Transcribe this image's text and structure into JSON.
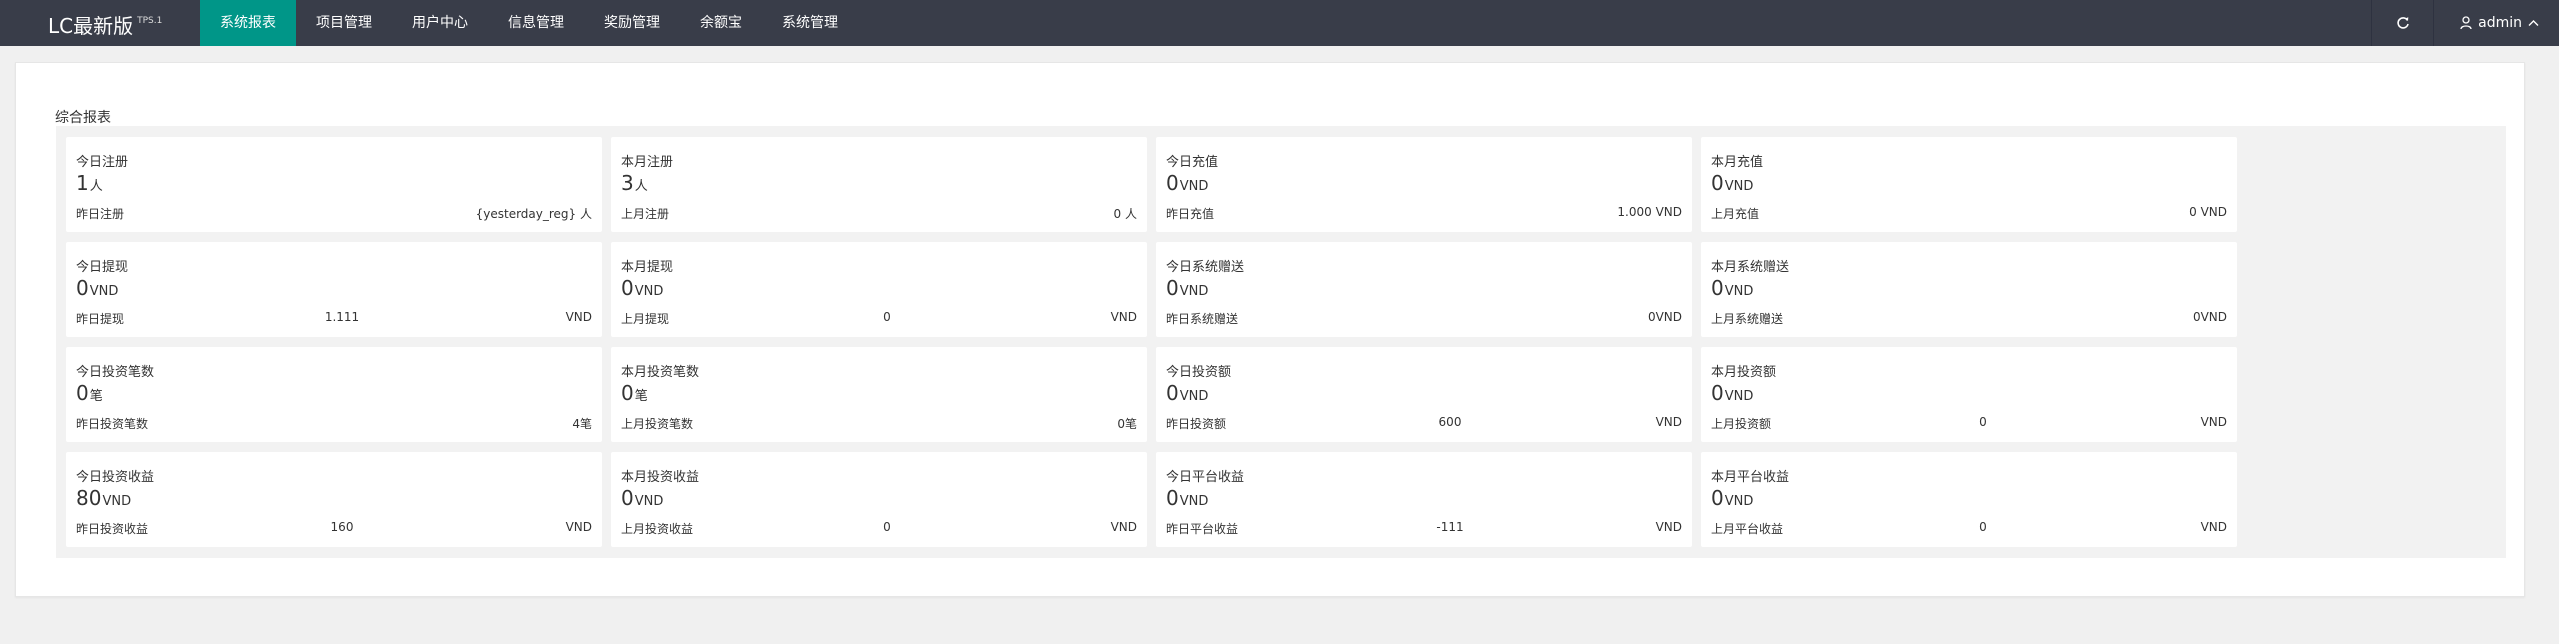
{
  "header": {
    "logo": "LC最新版",
    "logo_sup": "TPS.1",
    "nav": [
      "系统报表",
      "项目管理",
      "用户中心",
      "信息管理",
      "奖励管理",
      "余额宝",
      "系统管理"
    ],
    "admin": "admin"
  },
  "main": {
    "section_title": "综合报表",
    "cards": [
      {
        "title": "今日注册",
        "value": "1",
        "unit": "人",
        "prev_label": "昨日注册",
        "prev_mid": "",
        "prev_right": "{yesterday_reg} 人"
      },
      {
        "title": "本月注册",
        "value": "3",
        "unit": "人",
        "prev_label": "上月注册",
        "prev_mid": "",
        "prev_right": "0 人"
      },
      {
        "title": "今日充值",
        "value": "0",
        "unit": "VND",
        "prev_label": "昨日充值",
        "prev_mid": "",
        "prev_right": "1.000 VND"
      },
      {
        "title": "本月充值",
        "value": "0",
        "unit": "VND",
        "prev_label": "上月充值",
        "prev_mid": "",
        "prev_right": "0 VND"
      },
      {
        "title": "今日提现",
        "value": "0",
        "unit": "VND",
        "prev_label": "昨日提现",
        "prev_mid": "1.111",
        "prev_right": "VND"
      },
      {
        "title": "本月提现",
        "value": "0",
        "unit": "VND",
        "prev_label": "上月提现",
        "prev_mid": "0",
        "prev_right": "VND"
      },
      {
        "title": "今日系统赠送",
        "value": "0",
        "unit": "VND",
        "prev_label": "昨日系统赠送",
        "prev_mid": "",
        "prev_right": "0VND"
      },
      {
        "title": "本月系统赠送",
        "value": "0",
        "unit": "VND",
        "prev_label": "上月系统赠送",
        "prev_mid": "",
        "prev_right": "0VND"
      },
      {
        "title": "今日投资笔数",
        "value": "0",
        "unit": "笔",
        "prev_label": "昨日投资笔数",
        "prev_mid": "",
        "prev_right": "4笔"
      },
      {
        "title": "本月投资笔数",
        "value": "0",
        "unit": "笔",
        "prev_label": "上月投资笔数",
        "prev_mid": "",
        "prev_right": "0笔"
      },
      {
        "title": "今日投资额",
        "value": "0",
        "unit": "VND",
        "prev_label": "昨日投资额",
        "prev_mid": "600",
        "prev_right": "VND"
      },
      {
        "title": "本月投资额",
        "value": "0",
        "unit": "VND",
        "prev_label": "上月投资额",
        "prev_mid": "0",
        "prev_right": "VND"
      },
      {
        "title": "今日投资收益",
        "value": "80",
        "unit": "VND",
        "prev_label": "昨日投资收益",
        "prev_mid": "160",
        "prev_right": "VND"
      },
      {
        "title": "本月投资收益",
        "value": "0",
        "unit": "VND",
        "prev_label": "上月投资收益",
        "prev_mid": "0",
        "prev_right": "VND"
      },
      {
        "title": "今日平台收益",
        "value": "0",
        "unit": "VND",
        "prev_label": "昨日平台收益",
        "prev_mid": "-111",
        "prev_right": "VND"
      },
      {
        "title": "本月平台收益",
        "value": "0",
        "unit": "VND",
        "prev_label": "上月平台收益",
        "prev_mid": "0",
        "prev_right": "VND"
      }
    ]
  }
}
